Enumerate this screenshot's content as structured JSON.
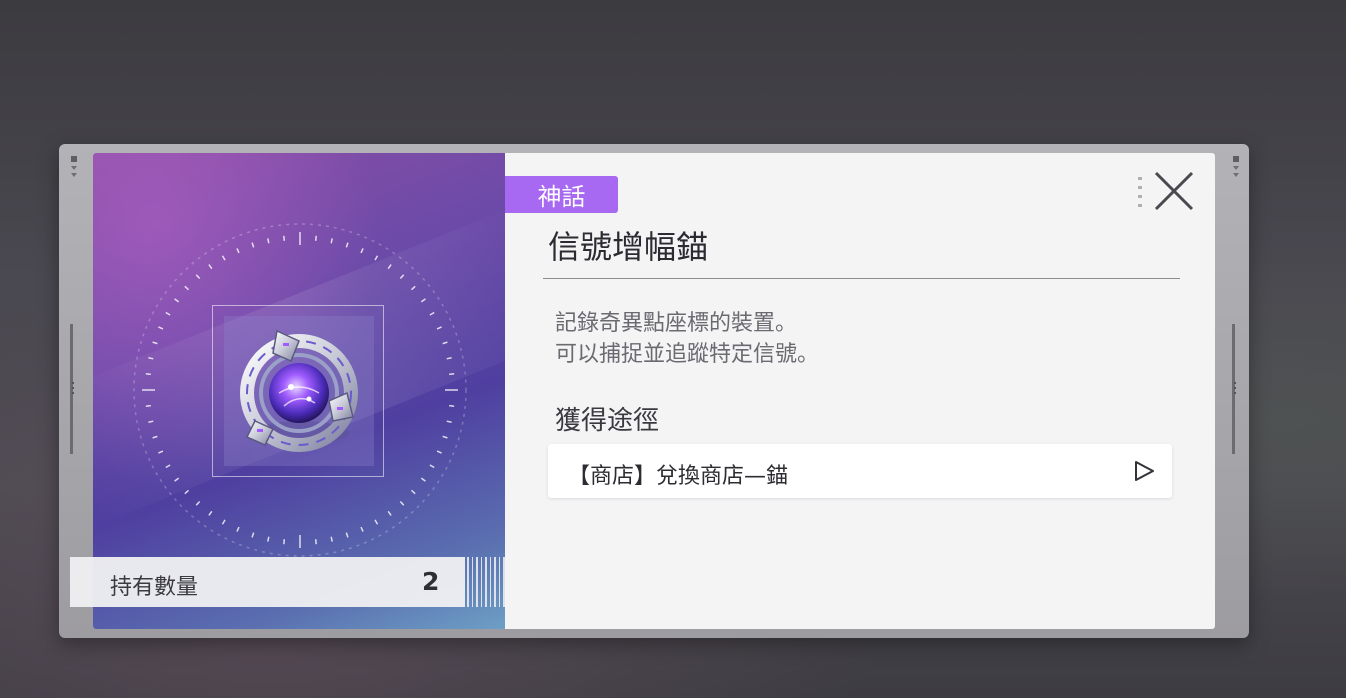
{
  "item": {
    "rarity": "神話",
    "name": "信號增幅錨",
    "description_line1": "記錄奇異點座標的裝置。",
    "description_line2": "可以捕捉並追蹤特定信號。",
    "quantity_label": "持有數量",
    "quantity_value": "2"
  },
  "obtain": {
    "title": "獲得途徑",
    "sources": [
      {
        "label": "【商店】兌換商店—錨"
      }
    ]
  },
  "colors": {
    "rarity_mythic": "#a768f2",
    "panel_bg": "#f4f4f5",
    "frame": "#a9a8ad"
  },
  "icons": {
    "close": "close-x-icon",
    "go": "play-triangle-icon",
    "item": "signal-amplifier-anchor-icon"
  }
}
